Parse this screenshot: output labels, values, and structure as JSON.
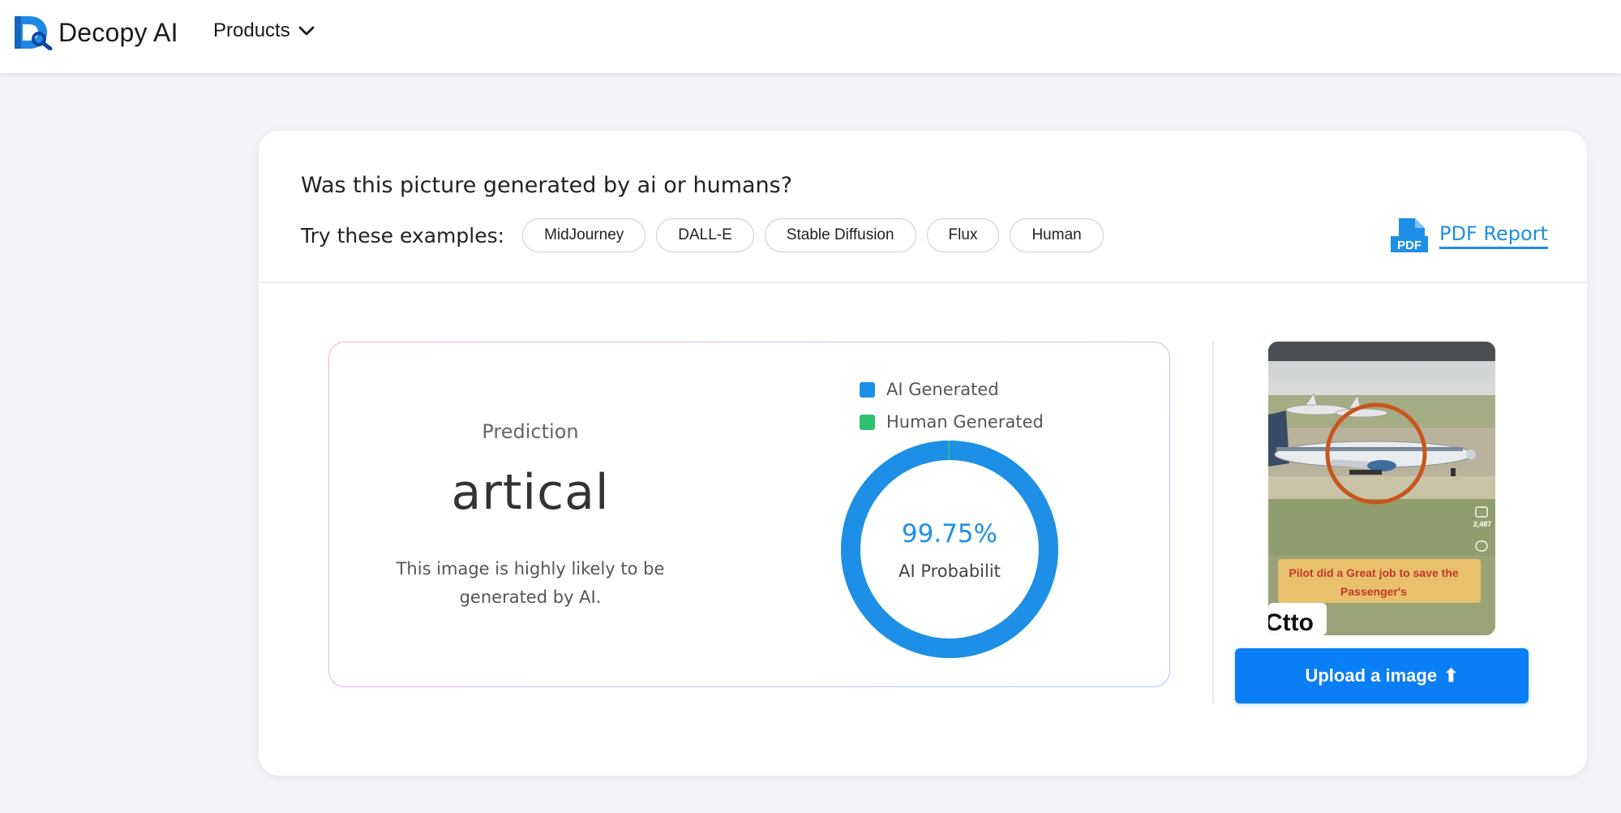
{
  "header": {
    "brand": "Decopy AI",
    "products_label": "Products"
  },
  "detector": {
    "question": "Was this picture generated by ai or humans?",
    "examples_label": "Try these examples:",
    "examples": [
      "MidJourney",
      "DALL-E",
      "Stable Diffusion",
      "Flux",
      "Human"
    ],
    "pdf_icon_text": "PDF",
    "pdf_label": "PDF Report"
  },
  "result": {
    "prediction_label": "Prediction",
    "prediction_value": "artical",
    "description": "This image is highly likely to be generated by AI.",
    "legend": [
      {
        "label": "AI Generated",
        "color": "#1e8fe6"
      },
      {
        "label": "Human Generated",
        "color": "#2fbf71"
      }
    ],
    "ai_probability": 99.75,
    "probability_text": "99.75%",
    "probability_caption": "AI Probabilit"
  },
  "preview": {
    "caption_line1": "Pilot did a Great job to save the",
    "caption_line2": "Passenger's",
    "likes": "2,487",
    "corner_text": "Ctto"
  },
  "upload": {
    "label": "Upload a image",
    "arrow": "⬆"
  },
  "colors": {
    "accent": "#1e8fe6",
    "button": "#0a7ef5",
    "human": "#2fbf71"
  }
}
